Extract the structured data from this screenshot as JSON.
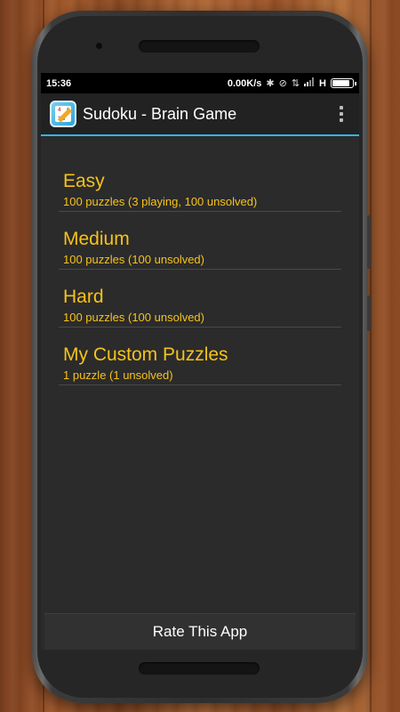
{
  "statusbar": {
    "time": "15:36",
    "net_speed": "0.00K/s",
    "network_type": "H",
    "icons": [
      "bluetooth-icon",
      "alarm-off-icon",
      "data-arrows-icon",
      "signal-icon",
      "battery-icon"
    ],
    "battery_level": 0.9
  },
  "actionbar": {
    "title": "Sudoku - Brain Game",
    "app_icon": "sudoku-app-icon",
    "overflow_icon": "overflow-menu-icon",
    "accent_color": "#33b5e5"
  },
  "difficulties": [
    {
      "title": "Easy",
      "subtitle": "100 puzzles (3 playing, 100 unsolved)"
    },
    {
      "title": "Medium",
      "subtitle": "100 puzzles (100 unsolved)"
    },
    {
      "title": "Hard",
      "subtitle": "100 puzzles (100 unsolved)"
    },
    {
      "title": "My Custom Puzzles",
      "subtitle": "1 puzzle (1 unsolved)"
    }
  ],
  "footer": {
    "rate_label": "Rate This App"
  },
  "colors": {
    "item_text": "#f6c21b",
    "screen_bg": "#2b2b2b"
  }
}
